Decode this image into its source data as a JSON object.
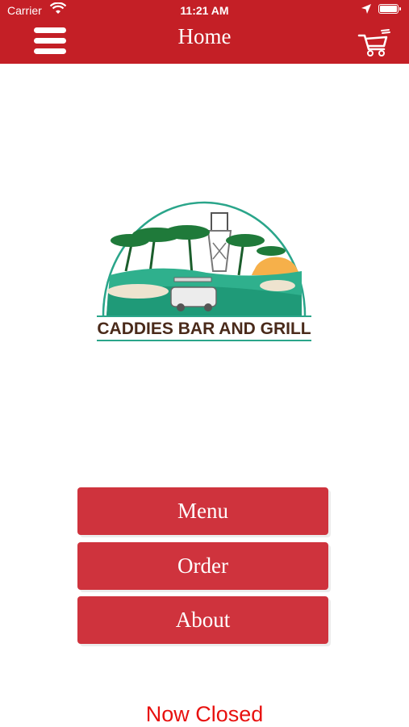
{
  "status_bar": {
    "carrier": "Carrier",
    "time": "11:21 AM"
  },
  "header": {
    "title": "Home",
    "menu_icon": "hamburger-menu-icon",
    "cart_icon": "shopping-cart-icon",
    "background_color": "#c41f26"
  },
  "logo": {
    "text": "CADDIES BAR AND GRILL"
  },
  "buttons": {
    "menu": "Menu",
    "order": "Order",
    "about": "About",
    "color": "#cf333d"
  },
  "status_message": {
    "text": "Now Closed",
    "color": "#e8110f"
  }
}
